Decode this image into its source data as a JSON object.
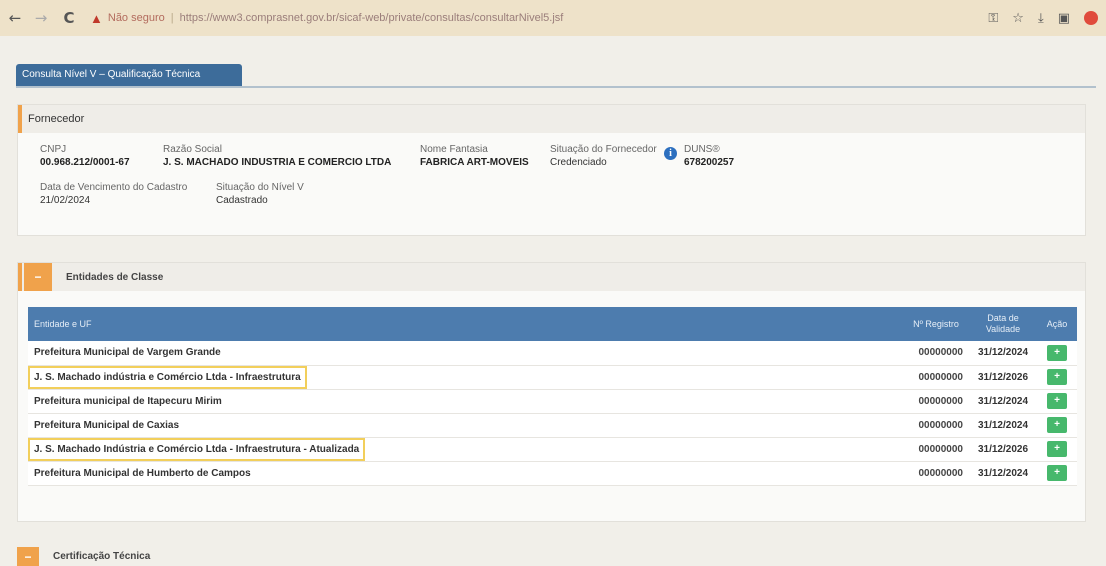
{
  "browser": {
    "insecure_label": "Não seguro",
    "url": "https://www3.comprasnet.gov.br/sicaf-web/private/consultas/consultarNivel5.jsf",
    "icons": [
      "back-icon",
      "forward-icon",
      "reload-icon",
      "warning-icon",
      "key-icon",
      "star-icon",
      "download-icon",
      "sidepanel-icon",
      "profile-icon"
    ]
  },
  "page_tab": "Consulta Nível V – Qualificação Técnica",
  "fornecedor": {
    "title": "Fornecedor",
    "cnpj_label": "CNPJ",
    "cnpj": "00.968.212/0001-67",
    "razao_label": "Razão Social",
    "razao": "J. S. MACHADO INDUSTRIA E COMERCIO LTDA",
    "fantasia_label": "Nome Fantasia",
    "fantasia": "FABRICA ART-MOVEIS",
    "situacao_label": "Situação do Fornecedor",
    "situacao": "Credenciado",
    "duns_label": "DUNS®",
    "duns": "678200257",
    "vencimento_label": "Data de Vencimento do Cadastro",
    "vencimento": "21/02/2024",
    "nivel_label": "Situação do Nível V",
    "nivel": "Cadastrado"
  },
  "entidades": {
    "toggle": "−",
    "title": "Entidades de Classe",
    "headers": {
      "entidade": "Entidade e UF",
      "registro": "Nº Registro",
      "validade": "Data de Validade",
      "acao": "Ação"
    },
    "action_label": "+",
    "rows": [
      {
        "name": "Prefeitura Municipal de Vargem Grande",
        "registro": "00000000",
        "validade": "31/12/2024"
      },
      {
        "name": "J. S. Machado indústria e Comércio Ltda - Infraestrutura",
        "registro": "00000000",
        "validade": "31/12/2026"
      },
      {
        "name": "Prefeitura municipal de Itapecuru Mirim",
        "registro": "00000000",
        "validade": "31/12/2024"
      },
      {
        "name": "Prefeitura Municipal de Caxias",
        "registro": "00000000",
        "validade": "31/12/2024"
      },
      {
        "name": "J. S. Machado Indústria e Comércio Ltda - Infraestrutura - Atualizada",
        "registro": "00000000",
        "validade": "31/12/2026"
      },
      {
        "name": "Prefeitura Municipal de Humberto de Campos",
        "registro": "00000000",
        "validade": "31/12/2024"
      }
    ]
  },
  "certificacao": {
    "toggle": "−",
    "title": "Certificação Técnica"
  },
  "colors": {
    "accent_orange": "#f0a24b",
    "header_blue": "#4d7cae",
    "tab_blue": "#3d6c9a",
    "action_green": "#47b86c",
    "highlight_yellow": "#f2cf5b"
  }
}
